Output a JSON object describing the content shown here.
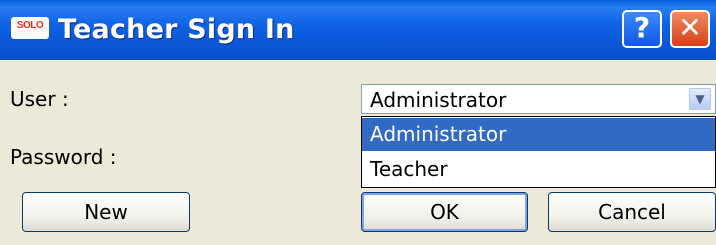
{
  "window": {
    "title": "Teacher Sign In",
    "app_icon_text": "SOLO",
    "help_button": "?",
    "close_button": "✕"
  },
  "form": {
    "user_label": "User :",
    "password_label": "Password :",
    "user_selected": "Administrator",
    "user_options": [
      "Administrator",
      "Teacher"
    ]
  },
  "buttons": {
    "new": "New",
    "ok": "OK",
    "cancel": "Cancel"
  },
  "icons": {
    "dropdown_arrow": "chevron-down-icon"
  },
  "colors": {
    "titlebar": "#0a5fe0",
    "selection": "#316ac5",
    "close": "#d6411c"
  }
}
